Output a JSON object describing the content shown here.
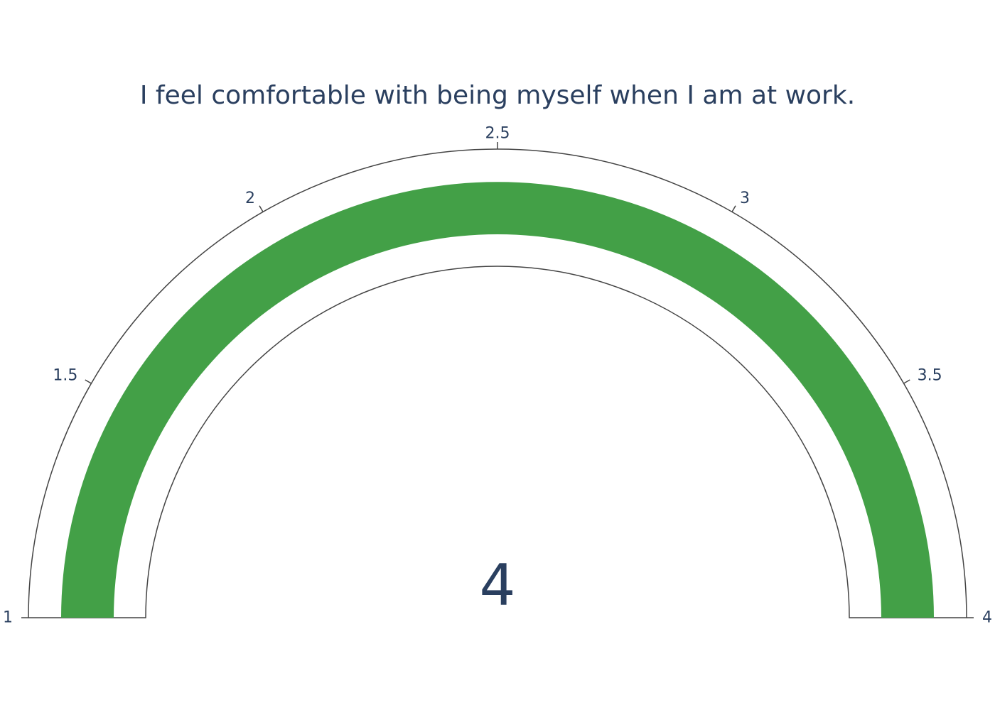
{
  "chart_data": {
    "type": "gauge",
    "title": "I feel comfortable with being myself when I am at work.",
    "value": 4,
    "value_label": "4",
    "range": [
      1,
      4
    ],
    "ticks": [
      1,
      1.5,
      2,
      2.5,
      3,
      3.5,
      4
    ],
    "tick_labels": [
      "1",
      "1.5",
      "2",
      "2.5",
      "3",
      "3.5",
      "4"
    ],
    "bar_color": "#43a047",
    "outline_color": "#444444",
    "text_color": "#2a3f5f"
  }
}
